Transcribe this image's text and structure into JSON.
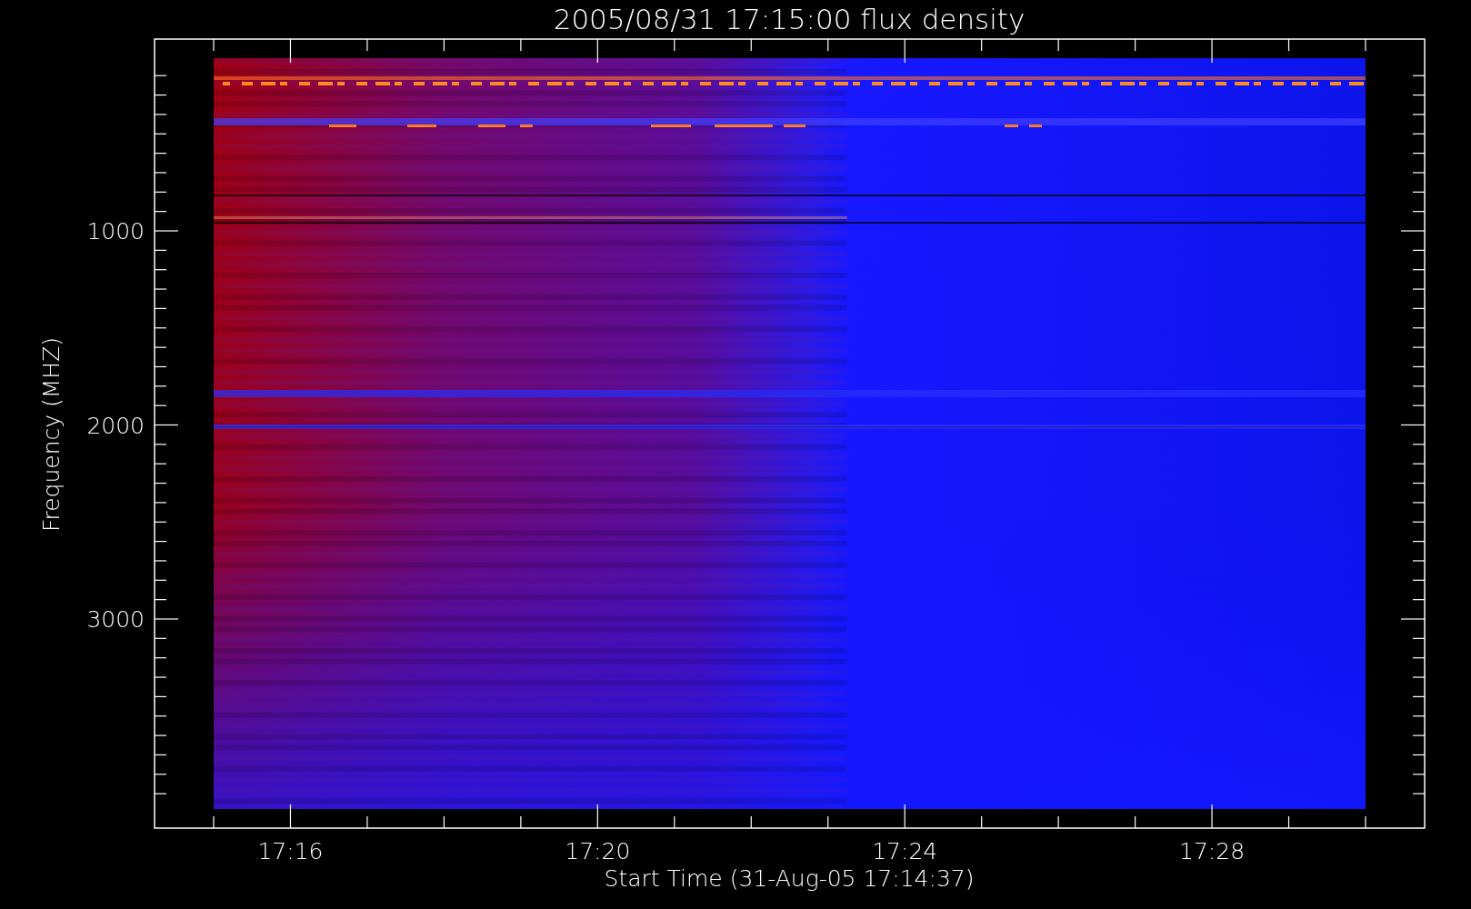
{
  "plot": {
    "title": "2005/08/31 17:15:00 flux density",
    "xlabel": "Start Time (31-Aug-05 17:14:37)",
    "ylabel": "Frequency (MHZ)",
    "xticks": [
      "17:16",
      "17:20",
      "17:24",
      "17:28"
    ],
    "yticks": [
      "1000",
      "2000",
      "3000"
    ]
  }
}
